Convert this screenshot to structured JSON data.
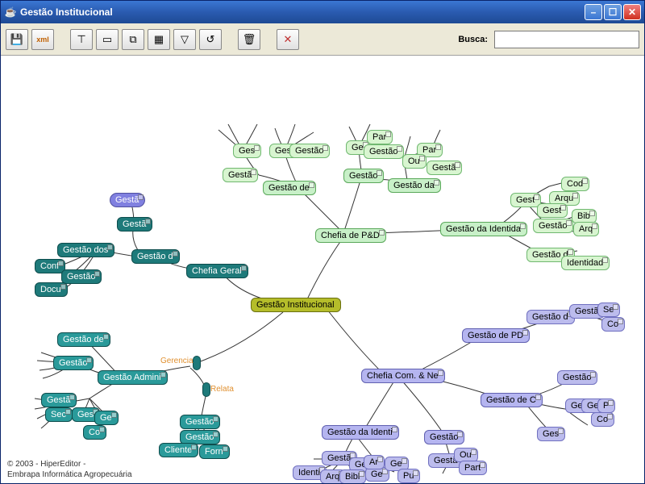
{
  "window": {
    "title": "Gestão Institucional"
  },
  "toolbar": {
    "search_label": "Busca:",
    "search_value": ""
  },
  "footer": {
    "line1": "© 2003 - HiperEditor -",
    "line2": "Embrapa Informática Agropecuária"
  },
  "labels": {
    "gerencia": "Gerencia",
    "relata": "Relata"
  },
  "nodes": {
    "center": "Gestão Institucional",
    "chefia_geral": "Chefia Geral",
    "chefia_pd": "Chefia de P&D",
    "chefia_com": "Chefia Com. & Ne",
    "gestao_adm": "Gestão Admini",
    "teal_gestao_d": "Gestão d",
    "teal_gestao_dos": "Gestão dos",
    "teal_conf": "Conf",
    "teal_gestao1": "Gestão",
    "teal_docu": "Docu",
    "teal_gesta_up": "Gestã",
    "teal_gesta_top": "Gestã",
    "teal_gestao_de": "Gestão de",
    "teal_gestao2": "Gestão",
    "teal_gesta2": "Gestã",
    "teal_sec": "Sec",
    "teal_ges": "Ges",
    "teal_ge": "Ge",
    "teal_co": "Co",
    "teal_gestao3": "Gestão",
    "teal_gestao4": "Gestão",
    "teal_cliente": "Cliente",
    "teal_forn": "Forn",
    "mint_gestao_de": "Gestão de",
    "mint_gesta1": "Gestã",
    "mint_ges1": "Ges",
    "mint_ges2": "Ges",
    "mint_gestao1": "Gestão",
    "mint_gestao2": "Gestão",
    "mint_gestao_da": "Gestão da",
    "mint_ge": "Ge",
    "mint_par1": "Par",
    "mint_gestao3": "Gestão",
    "mint_par2": "Par",
    "mint_ou": "Ou",
    "mint_gesta2": "Gestã",
    "mint_identida": "Gestão da Identida",
    "mint_gest1": "Gest",
    "mint_cod": "Cod",
    "mint_arqu": "Arqu",
    "mint_gest2": "Gest",
    "mint_bib": "Bib",
    "mint_gestao4": "Gestão",
    "mint_arq": "Arq",
    "mint_gestao_d": "Gestão d",
    "mint_identidad": "Identidad",
    "lav_gestao_pd": "Gestão de PD",
    "lav_gestao_d": "Gestão d",
    "lav_gesta1": "Gestã",
    "lav_se": "Se",
    "lav_co1": "Co",
    "lav_gestao_c": "Gestão de C",
    "lav_gestao1": "Gestão",
    "lav_ge1": "Ge",
    "lav_ge2": "Ge",
    "lav_pi": "P",
    "lav_co2": "Co",
    "lav_ges": "Ges",
    "lav_gestao_identi": "Gestão da Identi",
    "lav_gestao2": "Gestão",
    "lav_gesta2": "Gestã",
    "lav_ou": "Ou",
    "lav_part": "Part",
    "lav_gesta3": "Gestã",
    "lav_identi": "Identi",
    "lav_gest": "Gest",
    "lav_arq": "Arq",
    "lav_bibl": "Bibl",
    "lav_ge3": "Ge",
    "lav_ar": "Ar",
    "lav_ge4": "Ge",
    "lav_pu": "Pu"
  }
}
